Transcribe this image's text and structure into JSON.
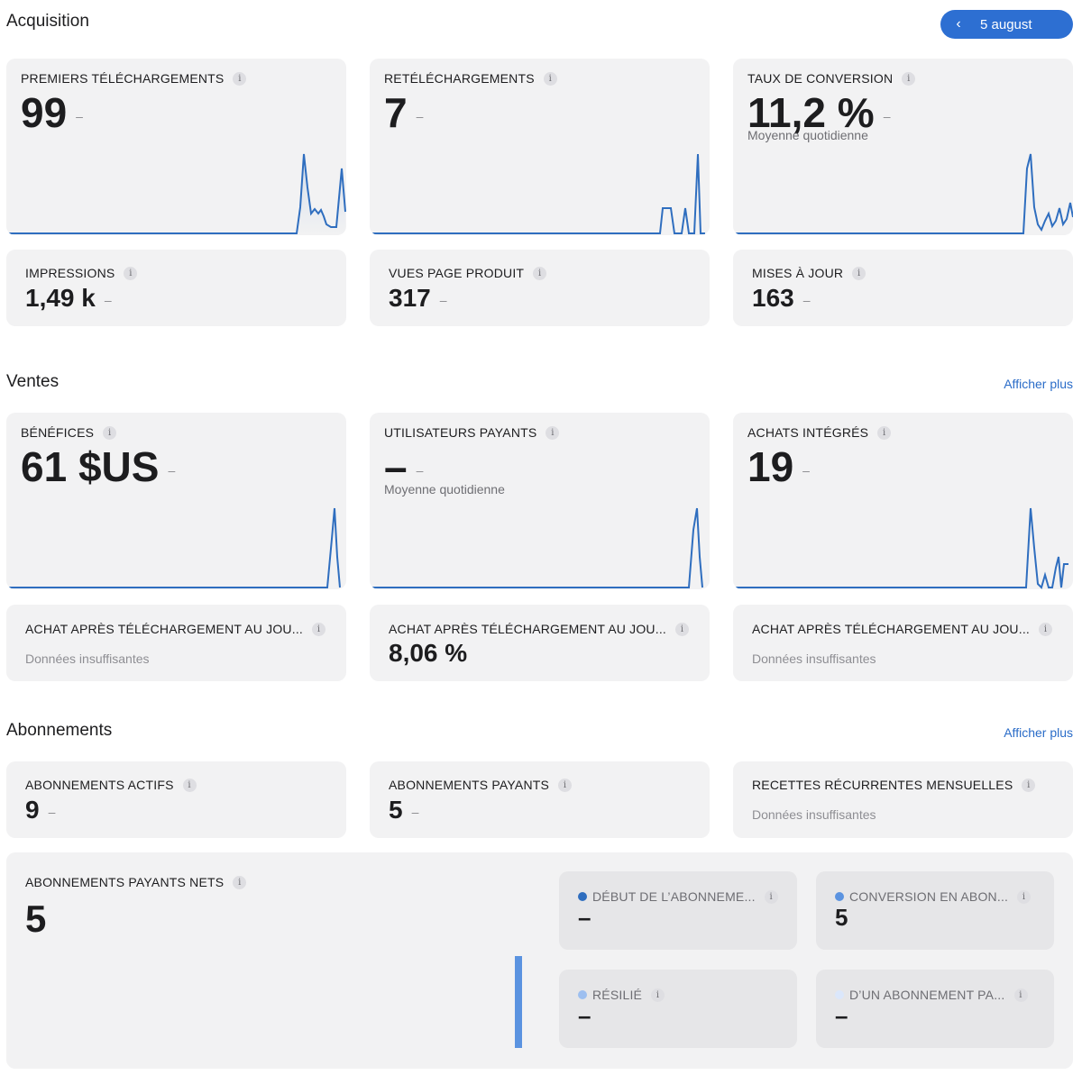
{
  "header": {
    "acquisition_title": "Acquisition",
    "date_label": "5 august"
  },
  "acquisition": {
    "premiers": {
      "label": "PREMIERS TÉLÉCHARGEMENTS",
      "value": "99",
      "change": "–"
    },
    "retelechargements": {
      "label": "RETÉLÉCHARGEMENTS",
      "value": "7",
      "change": "–"
    },
    "conversion": {
      "label": "TAUX DE CONVERSION",
      "value": "11,2 %",
      "change": "–",
      "sub": "Moyenne quotidienne"
    },
    "impressions": {
      "label": "IMPRESSIONS",
      "value": "1,49 k",
      "change": "–"
    },
    "vues": {
      "label": "VUES PAGE PRODUIT",
      "value": "317",
      "change": "–"
    },
    "mises": {
      "label": "MISES À JOUR",
      "value": "163",
      "change": "–"
    }
  },
  "ventes": {
    "title": "Ventes",
    "more": "Afficher plus",
    "benefices": {
      "label": "BÉNÉFICES",
      "value": "61 $US",
      "change": "–"
    },
    "utilisateurs": {
      "label": "UTILISATEURS PAYANTS",
      "value": "–",
      "change": "–",
      "sub": "Moyenne quotidienne"
    },
    "achats": {
      "label": "ACHATS INTÉGRÉS",
      "value": "19",
      "change": "–"
    },
    "achat1": {
      "label": "ACHAT APRÈS TÉLÉCHARGEMENT AU JOU...",
      "note": "Données insuffisantes"
    },
    "achat2": {
      "label": "ACHAT APRÈS TÉLÉCHARGEMENT AU JOU...",
      "value": "8,06 %"
    },
    "achat3": {
      "label": "ACHAT APRÈS TÉLÉCHARGEMENT AU JOU...",
      "note": "Données insuffisantes"
    }
  },
  "abonnements": {
    "title": "Abonnements",
    "more": "Afficher plus",
    "actifs": {
      "label": "ABONNEMENTS ACTIFS",
      "value": "9",
      "change": "–"
    },
    "payants": {
      "label": "ABONNEMENTS PAYANTS",
      "value": "5",
      "change": "–"
    },
    "recettes": {
      "label": "RECETTES RÉCURRENTES MENSUELLES",
      "note": "Données insuffisantes"
    },
    "nets": {
      "label": "ABONNEMENTS PAYANTS NETS",
      "value": "5"
    },
    "debut": {
      "label": "DÉBUT DE L’ABONNEME...",
      "value": "–"
    },
    "conv": {
      "label": "CONVERSION EN ABON...",
      "value": "5"
    },
    "resilie": {
      "label": "RÉSILIÉ",
      "value": "–"
    },
    "dun": {
      "label": "D’UN ABONNEMENT PA...",
      "value": "–"
    }
  },
  "icons": {
    "info": "i",
    "chevron": "‹"
  },
  "colors": {
    "accent": "#2d6fd2",
    "line": "#2f6ebf",
    "dot_dark": "#2f6ebf",
    "dot_mid": "#5b93e0",
    "dot_light": "#9dbff0",
    "dot_pale": "#dbe7fb"
  }
}
